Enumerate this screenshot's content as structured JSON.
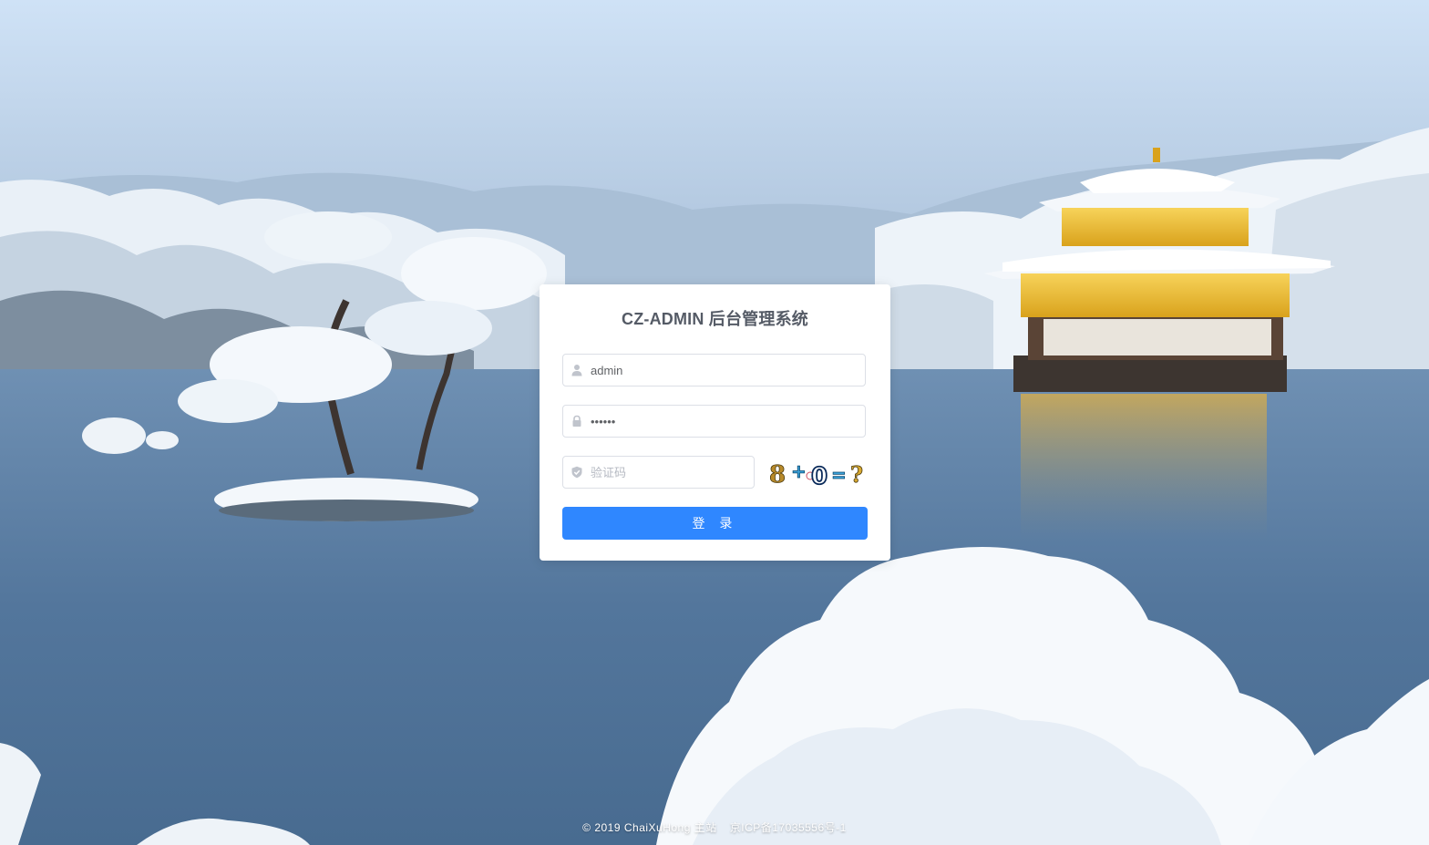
{
  "login": {
    "title": "CZ-ADMIN 后台管理系统",
    "username_value": "admin",
    "password_value": "••••••",
    "captcha_placeholder": "验证码",
    "captcha_text": "8+0=?",
    "submit_label": "登 录"
  },
  "footer": {
    "copyright": "© 2019 ChaiXuHong 主站",
    "icp": "京ICP备17035556号-1"
  },
  "colors": {
    "primary": "#2f87ff",
    "title": "#555b66",
    "border": "#dcdfe6"
  },
  "icons": [
    "user-icon",
    "lock-icon",
    "shield-icon"
  ]
}
